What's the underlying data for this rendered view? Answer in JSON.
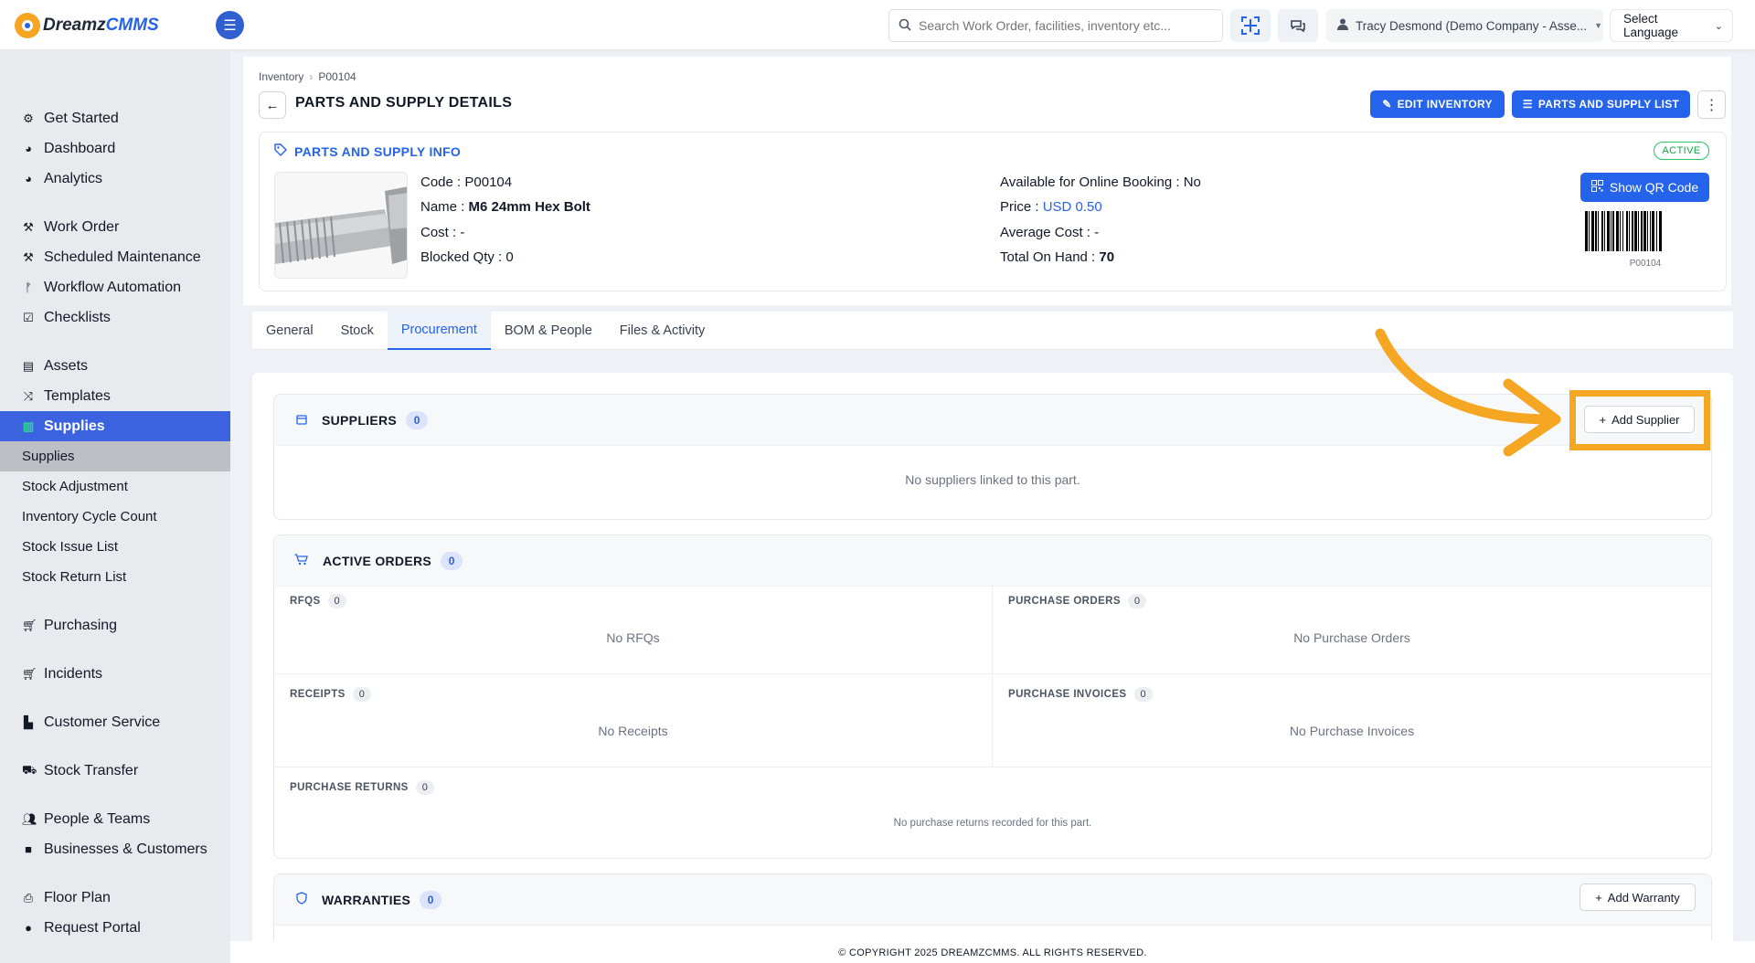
{
  "app": {
    "logo_dreamz": "Dreamz",
    "logo_cmms": "CMMS"
  },
  "topbar": {
    "search_placeholder": "Search Work Order, facilities, inventory etc...",
    "user": "Tracy Desmond (Demo Company - Asse...",
    "language": "Select Language"
  },
  "sidebar": {
    "items": [
      {
        "label": "Get Started",
        "icon": "gears-icon"
      },
      {
        "label": "Dashboard",
        "icon": "gauge-icon"
      },
      {
        "label": "Analytics",
        "icon": "chart-icon"
      },
      {
        "label": "Work Order",
        "icon": "wrench-icon"
      },
      {
        "label": "Scheduled Maintenance",
        "icon": "wrench-icon"
      },
      {
        "label": "Workflow Automation",
        "icon": "branch-icon"
      },
      {
        "label": "Checklists",
        "icon": "checkbox-icon"
      },
      {
        "label": "Assets",
        "icon": "archive-icon"
      },
      {
        "label": "Templates",
        "icon": "shuffle-icon"
      },
      {
        "label": "Supplies",
        "icon": "box-icon"
      },
      {
        "label": "Supplies"
      },
      {
        "label": "Stock Adjustment"
      },
      {
        "label": "Inventory Cycle Count"
      },
      {
        "label": "Stock Issue List"
      },
      {
        "label": "Stock Return List"
      },
      {
        "label": "Purchasing",
        "icon": "cart-icon"
      },
      {
        "label": "Incidents",
        "icon": "cart-icon"
      },
      {
        "label": "Customer Service",
        "icon": "file-icon"
      },
      {
        "label": "Stock Transfer",
        "icon": "truck-icon"
      },
      {
        "label": "People & Teams",
        "icon": "users-icon"
      },
      {
        "label": "Businesses & Customers",
        "icon": "video-icon"
      },
      {
        "label": "Floor Plan",
        "icon": "printer-icon"
      },
      {
        "label": "Request Portal",
        "icon": "comment-icon"
      }
    ]
  },
  "breadcrumb": {
    "root": "Inventory",
    "sep": "›",
    "current": "P00104"
  },
  "page": {
    "title": "PARTS AND SUPPLY DETAILS",
    "edit_btn": "EDIT INVENTORY",
    "list_btn": "PARTS AND SUPPLY LIST"
  },
  "info": {
    "title": "PARTS AND SUPPLY INFO",
    "status": "ACTIVE",
    "code_label": "Code :",
    "code": "P00104",
    "name_label": "Name :",
    "name": "M6 24mm Hex Bolt",
    "cost_label": "Cost :",
    "cost": "-",
    "blocked_label": "Blocked Qty :",
    "blocked": "0",
    "online_label": "Available for Online Booking :",
    "online": "No",
    "price_label": "Price :",
    "price": "USD 0.50",
    "avg_label": "Average Cost :",
    "avg": "-",
    "onhand_label": "Total On Hand :",
    "onhand": "70",
    "qr_btn": "Show QR Code",
    "barcode_text": "P00104"
  },
  "tabs": [
    "General",
    "Stock",
    "Procurement",
    "BOM & People",
    "Files & Activity"
  ],
  "active_tab": "Procurement",
  "suppliers": {
    "title": "SUPPLIERS",
    "count": "0",
    "add_btn": "Add Supplier",
    "empty": "No suppliers linked to this part."
  },
  "orders": {
    "title": "ACTIVE ORDERS",
    "count": "0",
    "rfqs": {
      "label": "RFQS",
      "count": "0",
      "empty": "No RFQs"
    },
    "pos": {
      "label": "PURCHASE ORDERS",
      "count": "0",
      "empty": "No Purchase Orders"
    },
    "receipts": {
      "label": "RECEIPTS",
      "count": "0",
      "empty": "No Receipts"
    },
    "invoices": {
      "label": "PURCHASE INVOICES",
      "count": "0",
      "empty": "No Purchase Invoices"
    },
    "returns": {
      "label": "PURCHASE RETURNS",
      "count": "0",
      "empty": "No purchase returns recorded for this part."
    }
  },
  "warranties": {
    "title": "WARRANTIES",
    "count": "0",
    "add_btn": "Add Warranty"
  },
  "footer": "© COPYRIGHT 2025 DREAMZCMMS. ALL RIGHTS RESERVED.",
  "colors": {
    "accent": "#2563eb",
    "annotation": "#f5a623",
    "active_green": "#16a34a"
  }
}
